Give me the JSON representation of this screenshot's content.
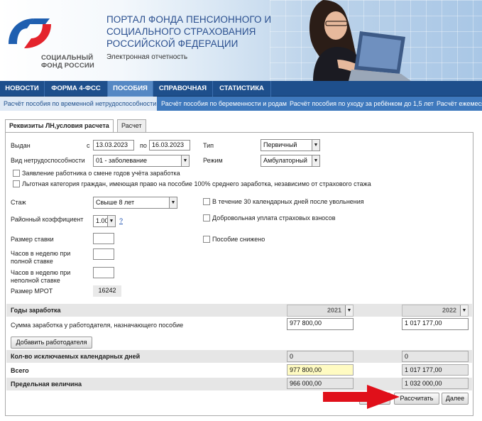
{
  "header": {
    "logo_line1": "СОЦИАЛЬНЫЙ",
    "logo_line2": "ФОНД РОССИИ",
    "title_line1": "ПОРТАЛ ФОНДА ПЕНСИОННОГО И",
    "title_line2": "СОЦИАЛЬНОГО СТРАХОВАНИЯ",
    "title_line3": "РОССИЙСКОЙ ФЕДЕРАЦИИ",
    "subtitle": "Электронная отчетность",
    "brand_color": "#2a4f8f"
  },
  "nav": {
    "items": [
      "НОВОСТИ",
      "ФОРМА 4-ФСС",
      "ПОСОБИЯ",
      "СПРАВОЧНАЯ",
      "СТАТИСТИКА"
    ],
    "active": "ПОСОБИЯ"
  },
  "subnav": {
    "items": [
      "Расчёт пособия по временной нетрудоспособности",
      "Расчёт пособия по беременности и родам",
      "Расчёт пособия по уходу за ребёнком до 1,5 лет",
      "Расчёт ежемеся"
    ]
  },
  "tabs": [
    "Реквизиты ЛН,условия расчета",
    "Расчет"
  ],
  "form": {
    "issued_label": "Выдан",
    "from_label": "с",
    "date_from": "13.03.2023",
    "to_label": "по",
    "date_to": "16.03.2023",
    "type_label": "Тип",
    "type_value": "Первичный",
    "kind_label": "Вид нетрудоспособности",
    "kind_value": "01 - заболевание",
    "mode_label": "Режим",
    "mode_value": "Амбулаторный",
    "cb_change_years": "Заявление работника о смене годов учёта заработка",
    "cb_privileged": "Льготная категория граждан, имеющая право на пособие 100% среднего заработка, независимо от страхового стажа",
    "seniority_label": "Стаж",
    "seniority_value": "Свыше 8 лет",
    "cb_30days": "В течение 30 календарных дней после увольнения",
    "regional_label": "Районный коэффициент",
    "regional_value": "1.00",
    "help_link": "?",
    "cb_voluntary": "Добровольная уплата страховых взносов",
    "rate_label": "Размер ставки",
    "cb_reduced": "Пособие снижено",
    "hours_full_label_1": "Часов в неделю при",
    "hours_full_label_2": "полной ставке",
    "hours_part_label_1": "Часов в неделю при",
    "hours_part_label_2": "неполной ставке",
    "mrot_label": "Размер МРОТ",
    "mrot_value": "16242"
  },
  "earnings": {
    "years_label": "Годы заработка",
    "year1": "2021",
    "year2": "2022",
    "sum_label": "Сумма заработка у работодателя, назначающего пособие",
    "sum1": "977 800,00",
    "sum2": "1 017 177,00",
    "add_employer": "Добавить работодателя",
    "excluded_label": "Кол-во исключаемых календарных дней",
    "excluded1": "0",
    "excluded2": "0",
    "total_label": "Всего",
    "total1": "977 800,00",
    "total2": "1 017 177,00",
    "limit_label": "Предельная величина",
    "limit1": "966 000,00",
    "limit2": "1 032 000,00",
    "highlight_color": "#fffbc2"
  },
  "buttons": {
    "clear_partial": "стить",
    "calculate": "Рассчитать",
    "next": "Далее"
  },
  "annotation_color": "#e0101a"
}
